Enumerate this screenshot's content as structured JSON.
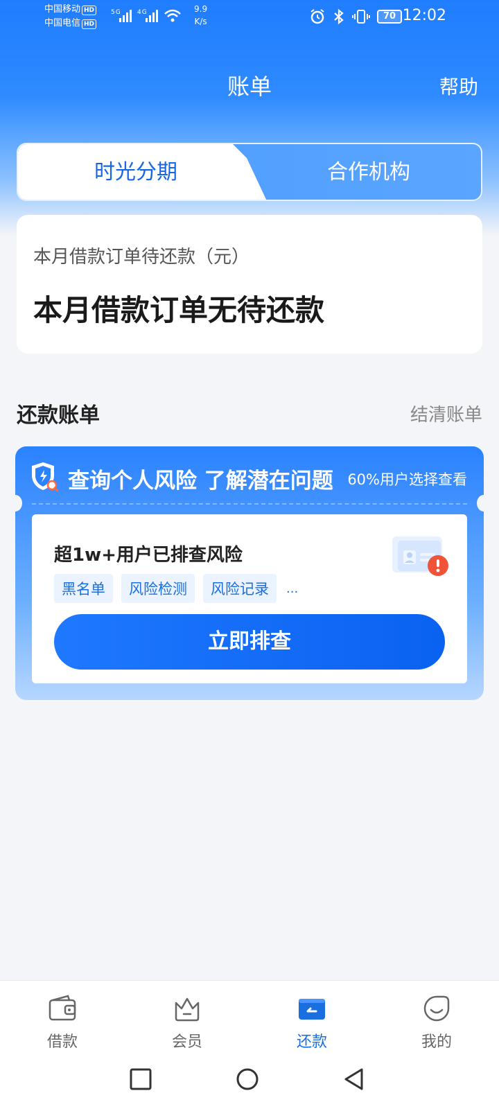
{
  "status_bar": {
    "carrier1": "中国移动",
    "carrier2": "中国电信",
    "hd": "HD",
    "network": "5G 4G",
    "speed_value": "9.9",
    "speed_unit": "K/s",
    "battery": "70",
    "time": "12:02"
  },
  "header": {
    "title": "账单",
    "help": "帮助"
  },
  "tabs": [
    {
      "label": "时光分期",
      "active": true
    },
    {
      "label": "合作机构",
      "active": false
    }
  ],
  "bill": {
    "label": "本月借款订单待还款（元）",
    "value": "本月借款订单无待还款"
  },
  "section": {
    "title": "还款账单",
    "link": "结清账单"
  },
  "promo": {
    "title": "查询个人风险 了解潜在问题",
    "subtitle": "60%用户选择查看",
    "inner_title": "超1w+用户已排查风险",
    "tags": [
      "黑名单",
      "风险检测",
      "风险记录"
    ],
    "more": "...",
    "button": "立即排查"
  },
  "bottom_nav": [
    {
      "label": "借款",
      "icon": "wallet-icon"
    },
    {
      "label": "会员",
      "icon": "crown-icon"
    },
    {
      "label": "还款",
      "icon": "repay-icon",
      "active": true
    },
    {
      "label": "我的",
      "icon": "smile-icon"
    }
  ],
  "colors": {
    "primary": "#1a6fe0",
    "header_blue": "#1f7dff",
    "background": "#f3f5f8"
  }
}
